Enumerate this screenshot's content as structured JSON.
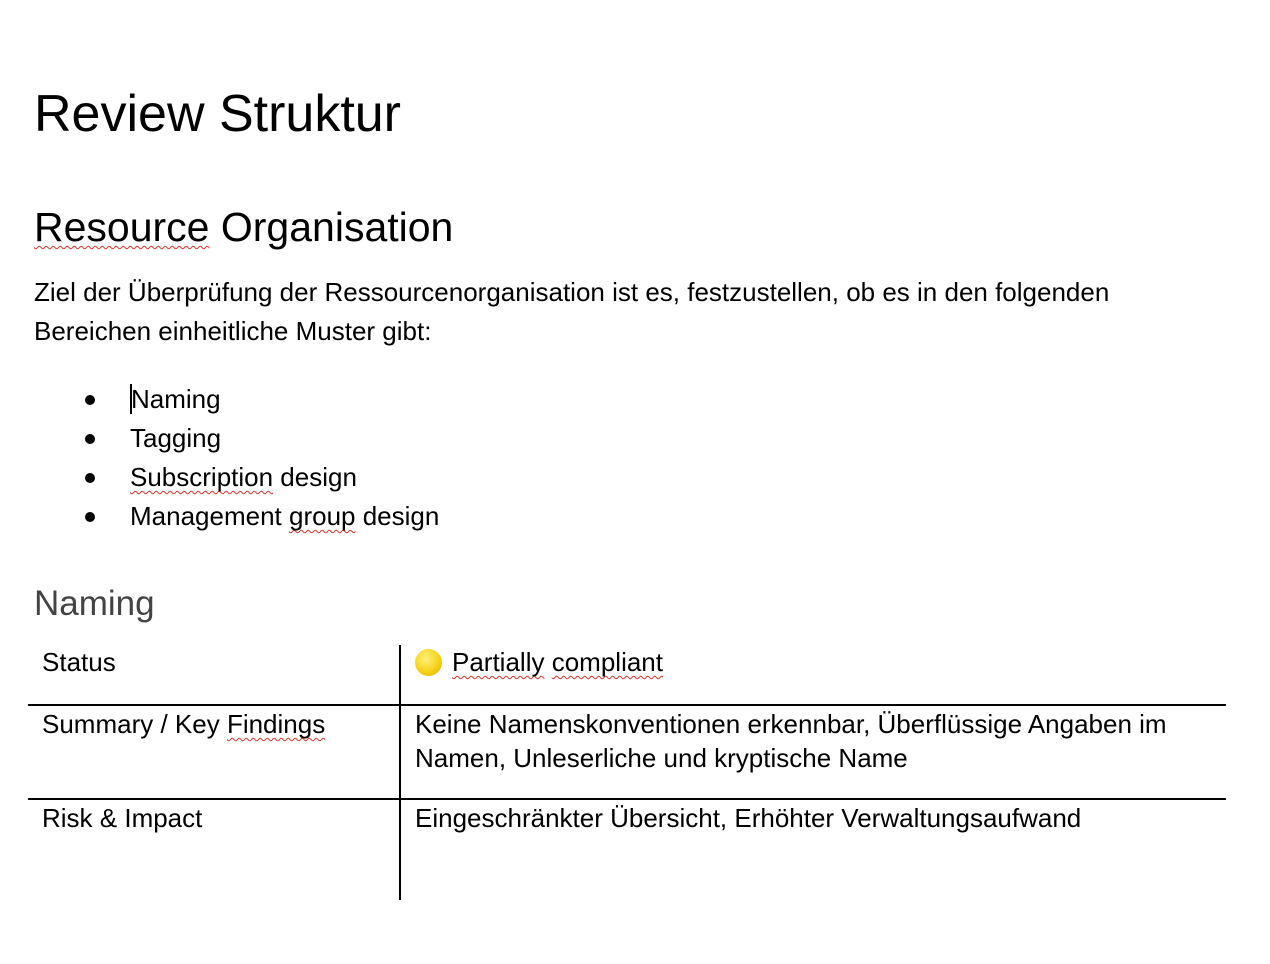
{
  "document": {
    "title": "Review Struktur",
    "section": {
      "heading_word1": "Resource",
      "heading_word2": "Organisation",
      "intro": "Ziel der Überprüfung der Ressourcenorganisation ist es, festzustellen, ob es in den folgenden Bereichen einheitliche Muster gibt:",
      "bullets": [
        {
          "text": "Naming"
        },
        {
          "text": "Tagging"
        },
        {
          "part1": "Subscription",
          "part2": " design"
        },
        {
          "part1": "Management ",
          "part2": "group",
          "part3": " design"
        }
      ]
    },
    "naming": {
      "heading": "Naming",
      "table": {
        "status_label": "Status",
        "status_icon": "yellow-circle-icon",
        "status_color": "#f7d21a",
        "status_value_word1": "Partially",
        "status_value_word2": "compliant",
        "summary_label_part1": "Summary / Key ",
        "summary_label_part2": "Findings",
        "summary_value": "Keine Namenskonventionen erkennbar, Überflüssige Angaben im Namen, Unleserliche und kryptische Name",
        "risk_label": "Risk & Impact",
        "risk_value": "Eingeschränkter Übersicht, Erhöhter Verwaltungsaufwand"
      }
    }
  }
}
